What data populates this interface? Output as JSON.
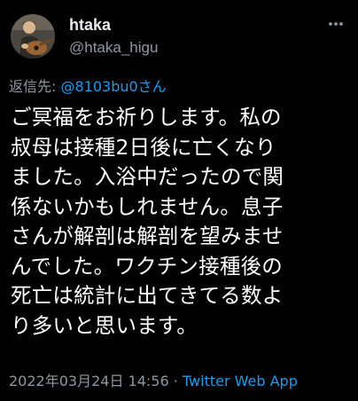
{
  "author": {
    "display_name": "htaka",
    "handle": "@htaka_higu"
  },
  "reply": {
    "prefix": "返信先: ",
    "mention": "@8103bu0さん"
  },
  "tweet": {
    "lines": [
      "ご冥福をお祈りします。私の",
      "叔母は接種2日後に亡くなり",
      "ました。入浴中だったので関",
      "係ないかもしれません。息子",
      "さんが解剖は解剖を望みませ",
      "んでした。ワクチン接種後の",
      "死亡は統計に出てきてる数よ",
      "り多いと思います。"
    ]
  },
  "meta": {
    "timestamp": "2022年03月24日 14:56",
    "separator": " · ",
    "source": "Twitter Web App"
  },
  "icons": {
    "avatar": "avatar-guitar-player",
    "more": "more-dots-icon"
  },
  "colors": {
    "background": "#000000",
    "text": "#ffffff",
    "secondary": "#8b98a5",
    "accent": "#1d9bf0"
  }
}
